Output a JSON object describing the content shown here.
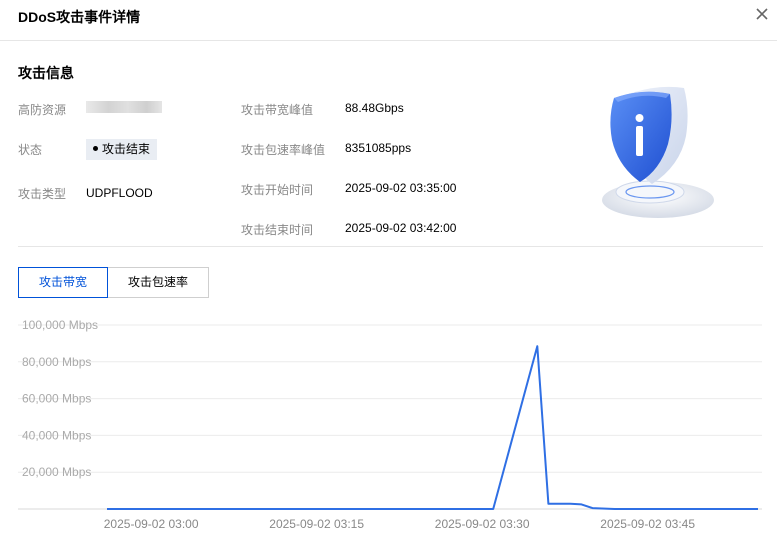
{
  "dialog": {
    "title": "DDoS攻击事件详情"
  },
  "info": {
    "section_title": "攻击信息",
    "col1": [
      {
        "label": "高防资源",
        "value": ""
      },
      {
        "label": "状态",
        "value": "攻击结束"
      },
      {
        "label": "攻击类型",
        "value": "UDPFLOOD"
      }
    ],
    "col2": [
      {
        "label": "攻击带宽峰值",
        "value": "88.48Gbps"
      },
      {
        "label": "攻击包速率峰值",
        "value": "8351085pps"
      },
      {
        "label": "攻击开始时间",
        "value": "2025-09-02 03:35:00"
      },
      {
        "label": "攻击结束时间",
        "value": "2025-09-02 03:42:00"
      }
    ]
  },
  "tabs": [
    {
      "label": "攻击带宽",
      "active": true
    },
    {
      "label": "攻击包速率",
      "active": false
    }
  ],
  "colors": {
    "accent": "#0052d9",
    "line": "#2f6fe4",
    "badge_bg": "#e9edf3"
  },
  "chart_data": {
    "type": "line",
    "y_unit": "Mbps",
    "ylim": [
      0,
      100000
    ],
    "y_ticks": [
      "100,000 Mbps",
      "80,000 Mbps",
      "60,000 Mbps",
      "40,000 Mbps",
      "20,000 Mbps"
    ],
    "y_tick_values": [
      100000,
      80000,
      60000,
      40000,
      20000
    ],
    "x_ticks": [
      "2025-09-02 03:00",
      "2025-09-02 03:15",
      "2025-09-02 03:30",
      "2025-09-02 03:45"
    ],
    "x_tick_minutes": [
      0,
      15,
      30,
      45
    ],
    "xlim_minutes": [
      -4,
      55
    ],
    "grid": true,
    "series": [
      {
        "points": [
          [
            "2025-09-02 02:56",
            0
          ],
          [
            "2025-09-02 03:30",
            0
          ],
          [
            "2025-09-02 03:31",
            0
          ],
          [
            "2025-09-02 03:35",
            88480
          ],
          [
            "2025-09-02 03:36",
            2800
          ],
          [
            "2025-09-02 03:38",
            2800
          ],
          [
            "2025-09-02 03:39",
            2500
          ],
          [
            "2025-09-02 03:40",
            500
          ],
          [
            "2025-09-02 03:42",
            0
          ],
          [
            "2025-09-02 03:55",
            0
          ]
        ]
      }
    ]
  }
}
